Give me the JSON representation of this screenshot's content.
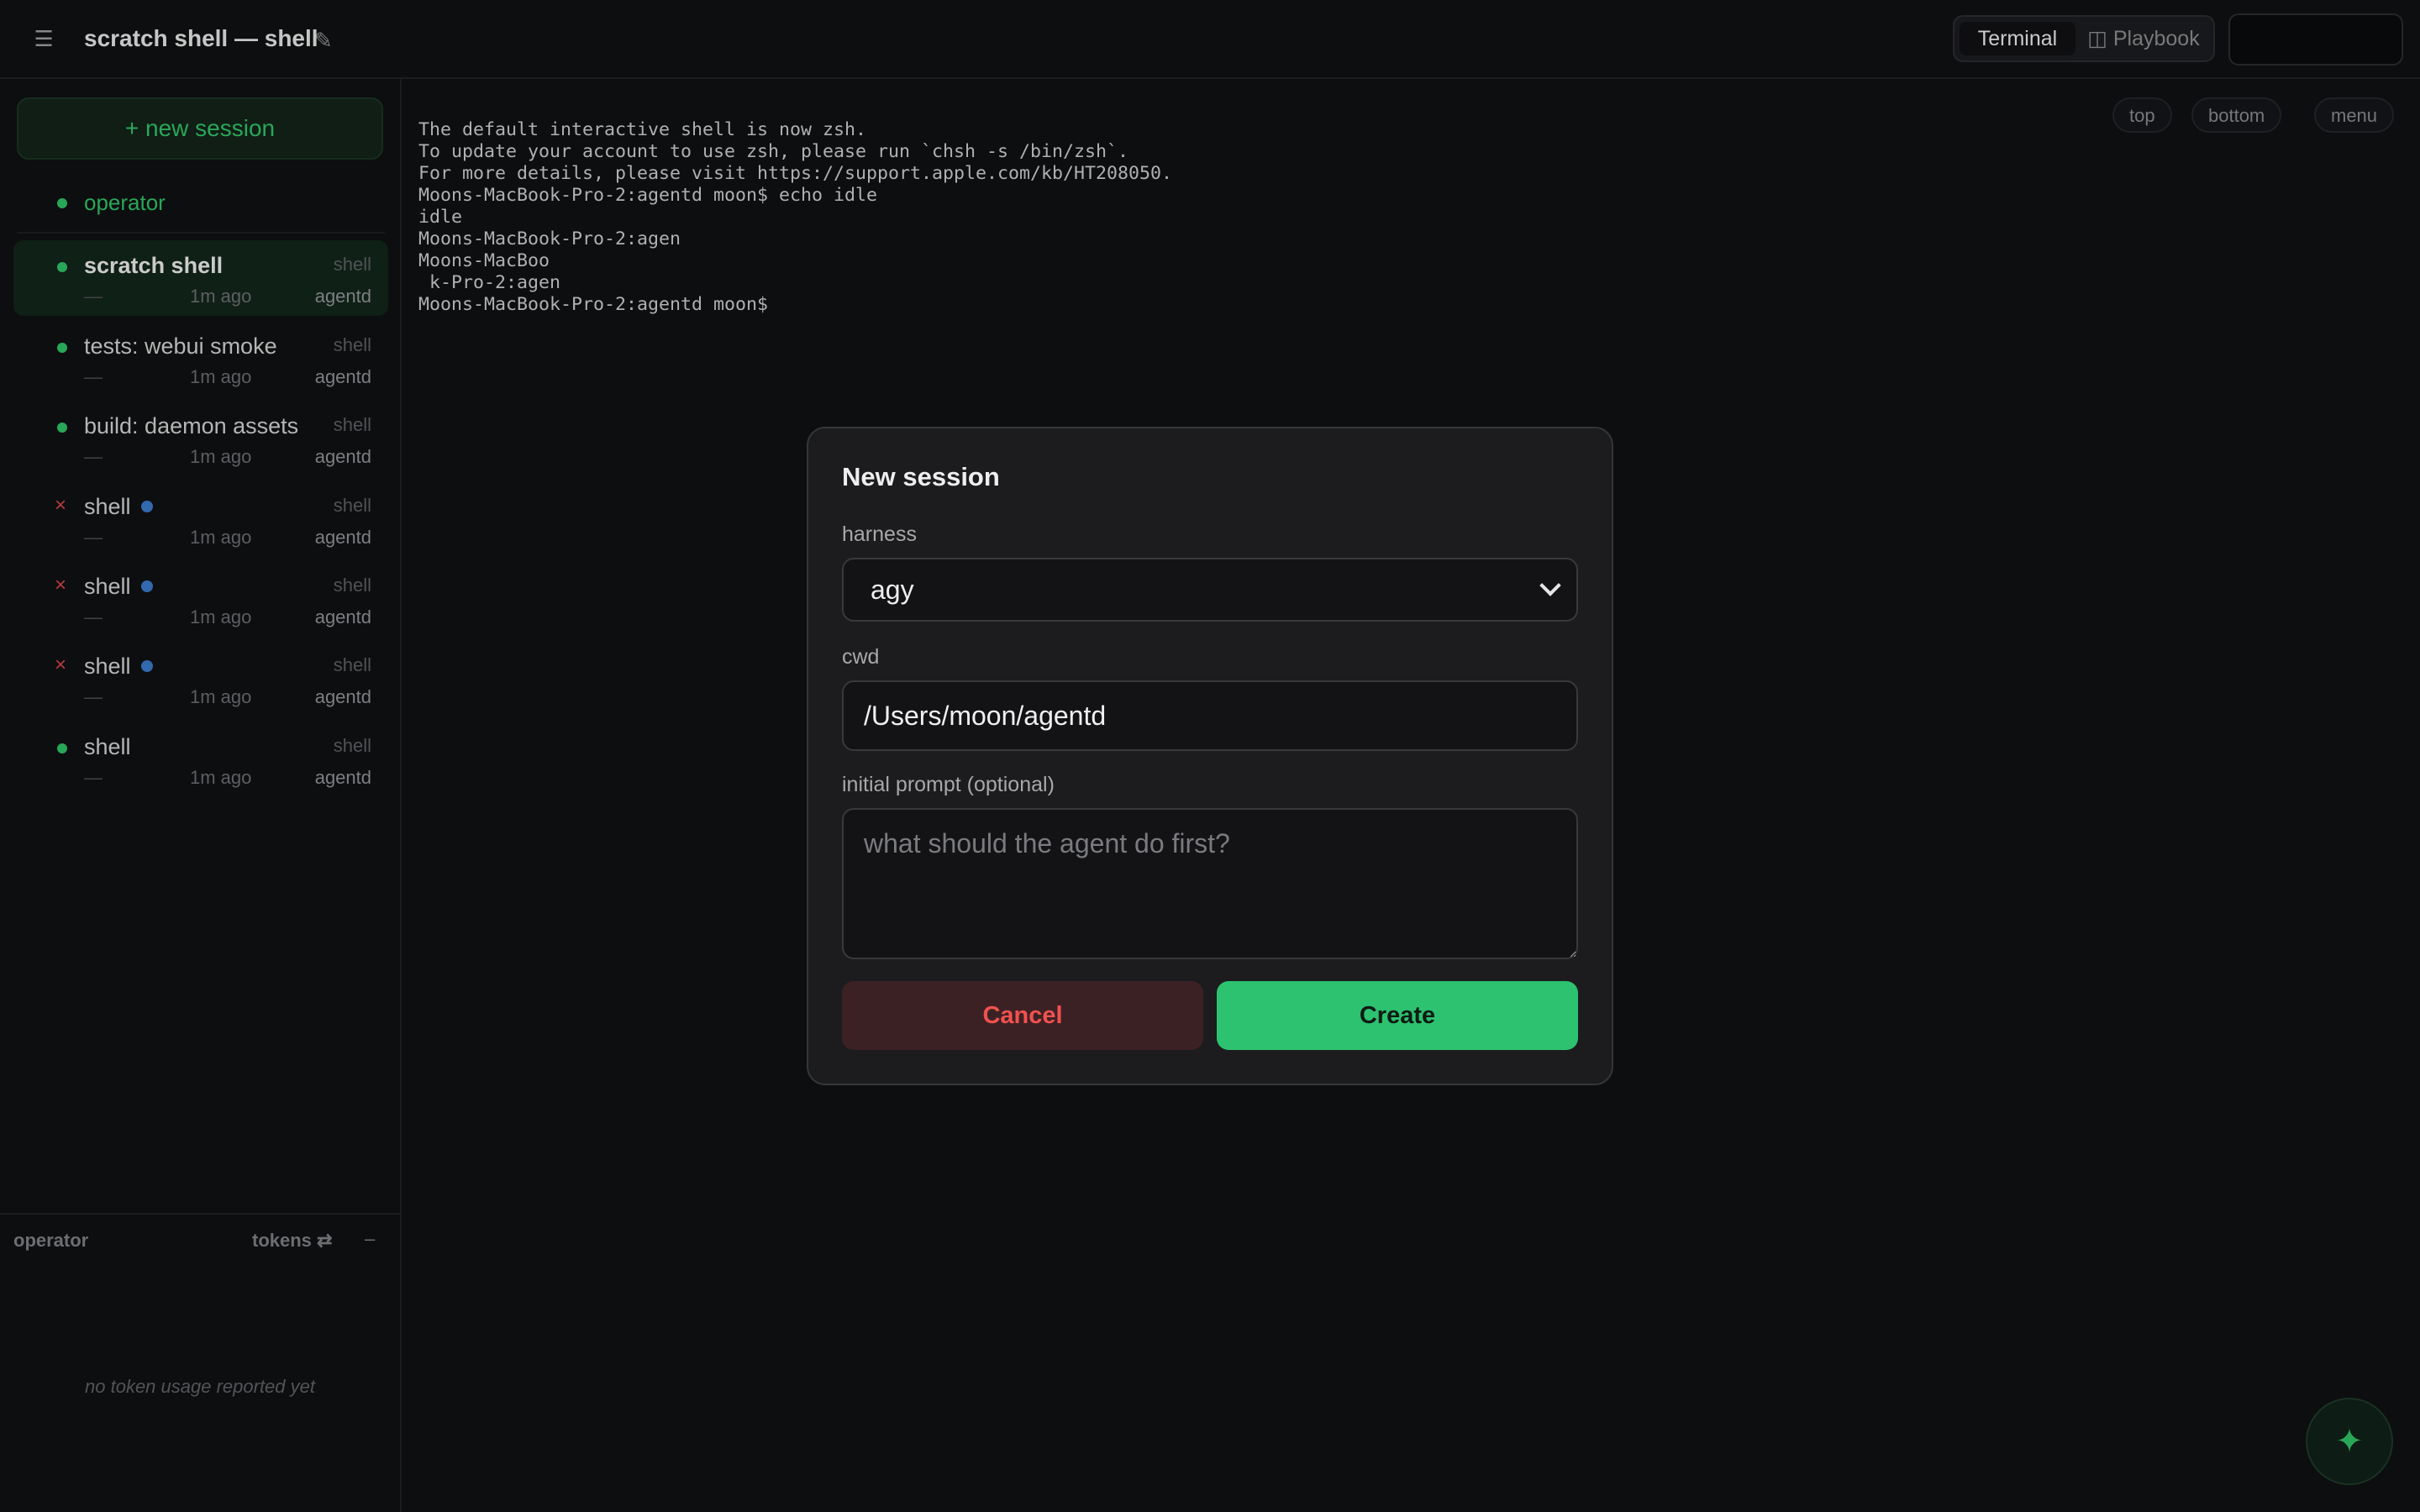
{
  "header": {
    "menu_icon": "☰",
    "title": "scratch shell — shell",
    "edit_icon": "✎",
    "view_tabs": {
      "terminal": "Terminal",
      "playbook_icon": "◫",
      "playbook": "Playbook"
    }
  },
  "sidebar": {
    "new_session_label": "+ new session",
    "operator_label": "operator",
    "sessions": [
      {
        "name": "scratch shell",
        "kind": "shell",
        "placeholder": "—",
        "time": "1m ago",
        "dir": "agentd",
        "status": "running",
        "active": true
      },
      {
        "name": "tests: webui smoke",
        "kind": "shell",
        "placeholder": "—",
        "time": "1m ago",
        "dir": "agentd",
        "status": "running"
      },
      {
        "name": "build: daemon assets",
        "kind": "shell",
        "placeholder": "—",
        "time": "1m ago",
        "dir": "agentd",
        "status": "running"
      },
      {
        "name": "shell",
        "kind": "shell",
        "placeholder": "—",
        "time": "1m ago",
        "dir": "agentd",
        "status": "exited",
        "unread": true
      },
      {
        "name": "shell",
        "kind": "shell",
        "placeholder": "—",
        "time": "1m ago",
        "dir": "agentd",
        "status": "exited",
        "unread": true
      },
      {
        "name": "shell",
        "kind": "shell",
        "placeholder": "—",
        "time": "1m ago",
        "dir": "agentd",
        "status": "exited",
        "unread": true
      },
      {
        "name": "shell",
        "kind": "shell",
        "placeholder": "—",
        "time": "1m ago",
        "dir": "agentd",
        "status": "running"
      }
    ],
    "exited_icon": "×",
    "tokens_panel": {
      "title": "operator",
      "toggle_label": "tokens ⇄",
      "minimize_icon": "–",
      "empty_text": "no token usage reported yet"
    }
  },
  "terminal": {
    "lines": [
      "The default interactive shell is now zsh.",
      "To update your account to use zsh, please run `chsh -s /bin/zsh`.",
      "For more details, please visit https://support.apple.com/kb/HT208050.",
      "Moons-MacBook-Pro-2:agentd moon$ echo idle",
      "idle",
      "Moons-MacBook-Pro-2:agen",
      "Moons-MacBoo",
      " k-Pro-2:agen",
      "Moons-MacBook-Pro-2:agentd moon$"
    ],
    "buttons": {
      "top": "top",
      "bottom": "bottom",
      "menu": "menu"
    },
    "fab_icon": "✦"
  },
  "modal": {
    "title": "New session",
    "harness_label": "harness",
    "harness_value": "agy",
    "cwd_label": "cwd",
    "cwd_value": "/Users/moon/agentd",
    "prompt_label": "initial prompt (optional)",
    "prompt_value": "",
    "prompt_placeholder": "what should the agent do first?",
    "cancel_label": "Cancel",
    "create_label": "Create"
  },
  "colors": {
    "accent_green": "#2fbf66",
    "create_button": "#2dc270",
    "cancel_text": "#f0514f",
    "exited_x": "#d04545",
    "unread_dot": "#3a78c8"
  }
}
